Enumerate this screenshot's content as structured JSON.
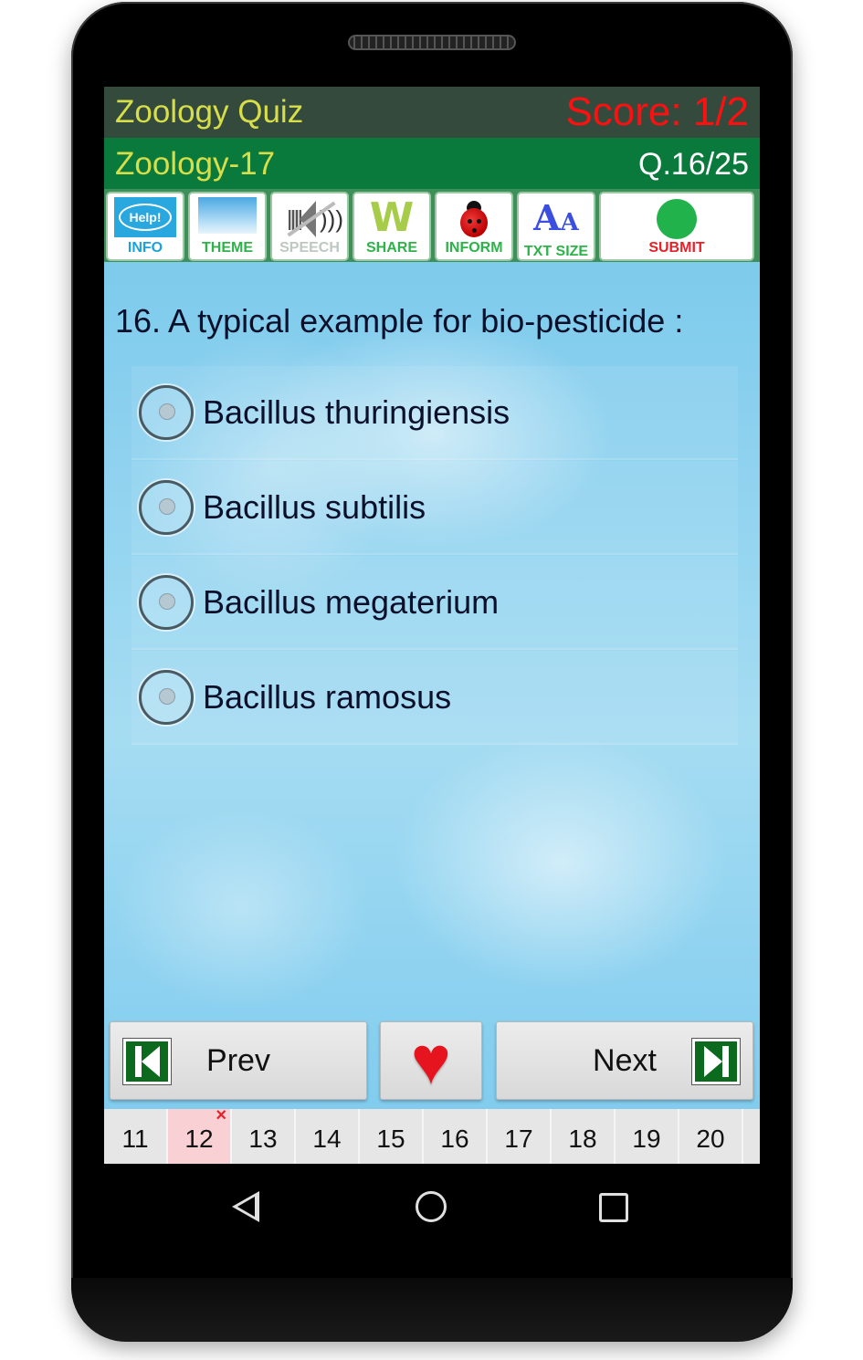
{
  "header": {
    "app_title": "Zoology Quiz",
    "score": "Score: 1/2",
    "quiz_name": "Zoology-17",
    "question_counter": "Q.16/25"
  },
  "toolbar": {
    "items": [
      {
        "label": "INFO",
        "icon": "help-icon"
      },
      {
        "label": "THEME",
        "icon": "theme-icon"
      },
      {
        "label": "SPEECH",
        "icon": "speech-muted-icon"
      },
      {
        "label": "SHARE",
        "icon": "share-icon"
      },
      {
        "label": "INFORM",
        "icon": "ladybug-icon"
      },
      {
        "label": "TXT SIZE",
        "icon": "text-size-icon"
      },
      {
        "label": "SUBMIT",
        "icon": "green-dot-icon"
      }
    ],
    "help_text": "Help!"
  },
  "question": {
    "text": "16. A typical example for bio-pesticide :",
    "options": [
      {
        "label": "Bacillus thuringiensis",
        "selected": false
      },
      {
        "label": "Bacillus subtilis",
        "selected": false
      },
      {
        "label": "Bacillus megaterium",
        "selected": false
      },
      {
        "label": "Bacillus ramosus",
        "selected": false
      }
    ]
  },
  "navigation": {
    "prev_label": "Prev",
    "next_label": "Next",
    "favorite_icon": "♥"
  },
  "question_strip": {
    "numbers": [
      "11",
      "12",
      "13",
      "14",
      "15",
      "16",
      "17",
      "18",
      "19",
      "20"
    ],
    "wrong": [
      "12"
    ],
    "wrong_mark": "×"
  },
  "colors": {
    "title_bar": "#344a3c",
    "sub_bar": "#0a7a3c",
    "title_text": "#d8de4a",
    "score_text": "#ff1010",
    "submit_dot": "#22b24c",
    "wrong_bg": "#f9d0d4"
  }
}
